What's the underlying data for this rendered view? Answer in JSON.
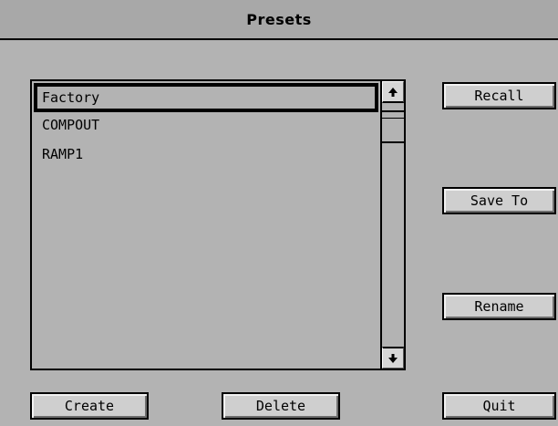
{
  "window": {
    "title": "Presets"
  },
  "presets": {
    "items": [
      {
        "label": "Factory",
        "selected": true
      },
      {
        "label": "COMPOUT",
        "selected": false
      },
      {
        "label": "RAMP1",
        "selected": false
      }
    ]
  },
  "scrollbar": {
    "up_icon": "arrow-up-icon",
    "down_icon": "arrow-down-icon"
  },
  "buttons": {
    "recall": "Recall",
    "save_to": "Save To",
    "rename": "Rename",
    "quit": "Quit",
    "create": "Create",
    "delete": "Delete"
  },
  "colors": {
    "background": "#b3b3b3",
    "button_face": "#cfcfcf",
    "border": "#000000"
  }
}
